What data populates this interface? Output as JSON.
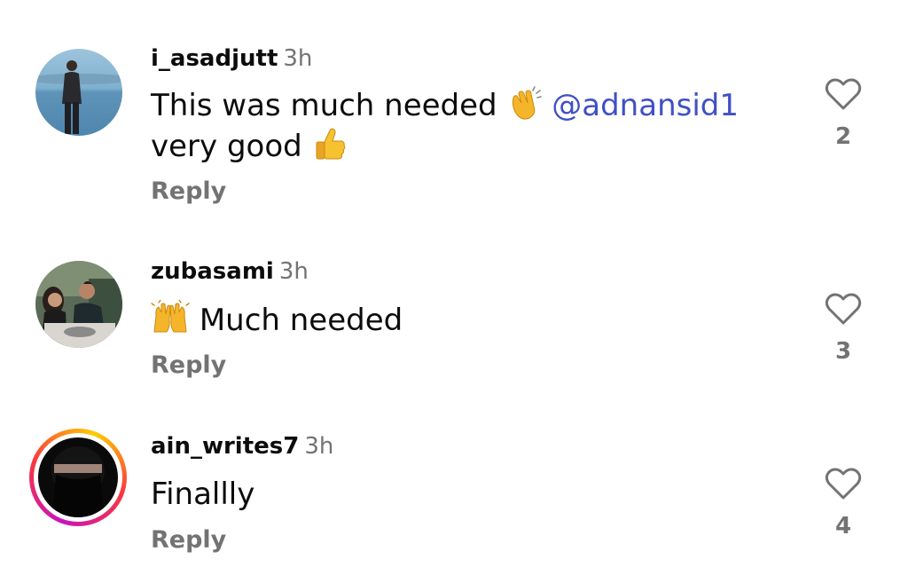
{
  "comments": [
    {
      "username": "i_asadjutt",
      "time": "3h",
      "text_part1": "This was much needed",
      "emoji1": "clapping-hands",
      "mention": "@adnansid1",
      "text_line2": "very good",
      "emoji2": "thumbs-up",
      "reply_label": "Reply",
      "like_count": "2",
      "has_story_ring": false
    },
    {
      "username": "zubasami",
      "time": "3h",
      "emoji1": "raising-hands",
      "text": "Much needed",
      "reply_label": "Reply",
      "like_count": "3",
      "has_story_ring": false
    },
    {
      "username": "ain_writes7",
      "time": "3h",
      "text": "Finallly",
      "reply_label": "Reply",
      "like_count": "4",
      "has_story_ring": true
    }
  ],
  "colors": {
    "text": "#0c0c0c",
    "secondary": "#737373",
    "mention": "#4150c4",
    "story_ring_start": "#c913b9",
    "story_ring_mid": "#f9373f",
    "story_ring_end": "#fecd00"
  }
}
